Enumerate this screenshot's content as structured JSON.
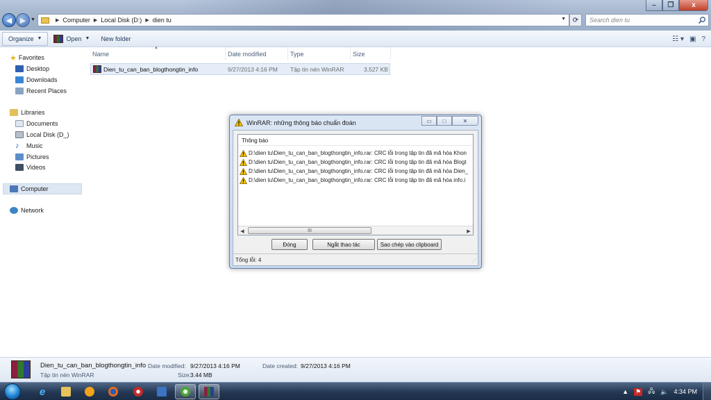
{
  "window": {
    "minimize_label": "–",
    "maximize_label": "❐",
    "close_label": "x"
  },
  "address": {
    "segments": [
      "Computer",
      "Local Disk (D:)",
      "dien tu"
    ],
    "search_placeholder": "Search dien tu"
  },
  "toolbar": {
    "organize_label": "Organize",
    "open_label": "Open",
    "new_folder_label": "New folder"
  },
  "sidebar": {
    "favorites": "Favorites",
    "desktop": "Desktop",
    "downloads": "Downloads",
    "recent_places": "Recent Places",
    "libraries": "Libraries",
    "documents": "Documents",
    "local_disk": "Local Disk (D_)",
    "music": "Music",
    "pictures": "Pictures",
    "videos": "Videos",
    "computer": "Computer",
    "network": "Network"
  },
  "columns": {
    "name": "Name",
    "date_modified": "Date modified",
    "type": "Type",
    "size": "Size"
  },
  "file": {
    "name": "Dien_tu_can_ban_blogthongtin_info",
    "date_modified": "9/27/2013 4:16 PM",
    "type": "Tập tin nén WinRAR",
    "size": "3,527 KB"
  },
  "details": {
    "name": "Dien_tu_can_ban_blogthongtin_info",
    "type": "Tập tin nén WinRAR",
    "date_modified_label": "Date modified:",
    "date_modified": "9/27/2013 4:16 PM",
    "size_label": "Size:",
    "size": "3.44 MB",
    "date_created_label": "Date created:",
    "date_created": "9/27/2013 4:16 PM"
  },
  "dialog": {
    "title": "WinRAR: những thông báo chuẩn đoán",
    "list_header": "Thông báo",
    "messages": [
      "D:\\dien tu\\Dien_tu_can_ban_blogthongtin_info.rar: CRC lỗi trong tập tin đã mã hóa Khon",
      "D:\\dien tu\\Dien_tu_can_ban_blogthongtin_info.rar: CRC lỗi trong tập tin đã mã hóa Blogt",
      "D:\\dien tu\\Dien_tu_can_ban_blogthongtin_info.rar: CRC lỗi trong tập tin đã mã hóa Dien_",
      "D:\\dien tu\\Dien_tu_can_ban_blogthongtin_info.rar: CRC lỗi trong tập tin đã mã hóa info.i"
    ],
    "scroll_thumb_label": "III",
    "close_button": "Đóng",
    "break_button": "Ngắt thao tác",
    "copy_button": "Sao chép vào clipboard",
    "status": "Tổng lỗi: 4"
  },
  "taskbar": {
    "clock": "4:34 PM"
  },
  "colors": {
    "accent": "#2c62b4",
    "warning": "#f3c400",
    "selection": "#e5edf8"
  }
}
